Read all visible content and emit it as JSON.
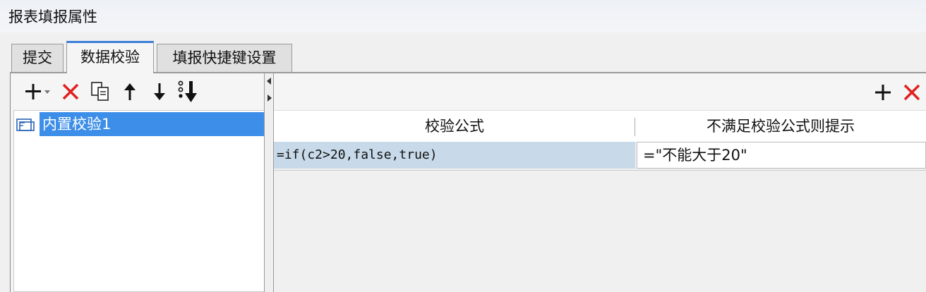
{
  "window": {
    "title": "报表填报属性"
  },
  "tabs": [
    {
      "label": "提交",
      "active": false
    },
    {
      "label": "数据校验",
      "active": true
    },
    {
      "label": "填报快捷键设置",
      "active": false
    }
  ],
  "left_toolbar": {
    "buttons": [
      "add-icon",
      "delete-icon",
      "copy-icon",
      "move-up-icon",
      "move-down-icon",
      "move-to-bottom-icon"
    ]
  },
  "tree": {
    "items": [
      {
        "label": "内置校验1",
        "selected": true
      }
    ]
  },
  "right_toolbar": {
    "buttons": [
      "add-icon",
      "delete-icon"
    ]
  },
  "grid": {
    "columns": [
      "校验公式",
      "不满足校验公式则提示"
    ],
    "rows": [
      {
        "formula": "=if(c2>20,false,true)",
        "message": "=\"不能大于20\""
      }
    ]
  },
  "colors": {
    "accent": "#3b7fd8",
    "selection": "#3d8ee8",
    "row_highlight": "#c8dae9",
    "delete_red": "#e02020"
  }
}
